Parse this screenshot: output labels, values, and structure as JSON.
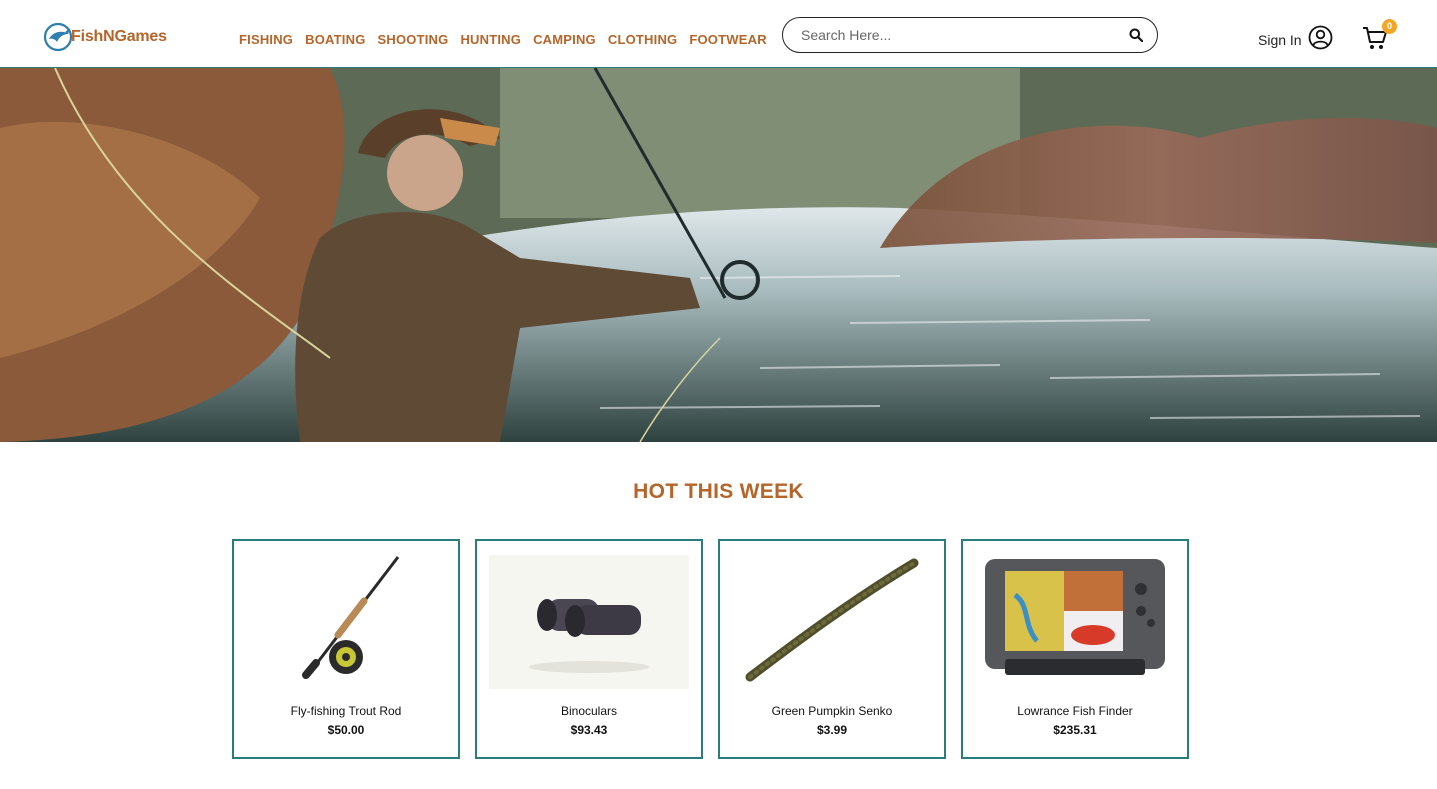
{
  "brand": {
    "name": "FishNGames"
  },
  "nav": {
    "items": [
      "FISHING",
      "BOATING",
      "SHOOTING",
      "HUNTING",
      "CAMPING",
      "CLOTHING",
      "FOOTWEAR"
    ]
  },
  "search": {
    "placeholder": "Search Here...",
    "value": ""
  },
  "account": {
    "sign_in_label": "Sign In"
  },
  "cart": {
    "count": "0"
  },
  "section": {
    "title": "HOT THIS WEEK"
  },
  "products": [
    {
      "name": "Fly-fishing Trout Rod",
      "price": "$50.00",
      "image": "fly-rod-image"
    },
    {
      "name": "Binoculars",
      "price": "$93.43",
      "image": "binoculars-image"
    },
    {
      "name": "Green Pumpkin Senko",
      "price": "$3.99",
      "image": "senko-lure-image"
    },
    {
      "name": "Lowrance Fish Finder",
      "price": "$235.31",
      "image": "fish-finder-image"
    }
  ],
  "colors": {
    "accent": "#b5652a",
    "border": "#2a7d7d",
    "badge": "#f5a623"
  }
}
